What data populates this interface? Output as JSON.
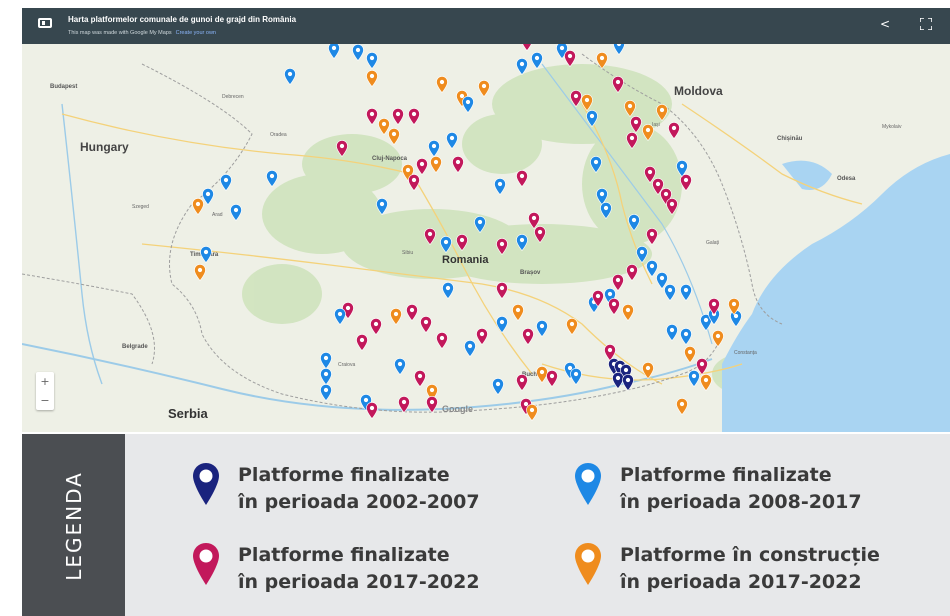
{
  "header": {
    "title": "Harta platformelor comunale de gunoi de grajd din România",
    "subtitle": "This map was made with Google My Maps",
    "subtitle_link": "Create your own",
    "menu_icon": "map-layers-icon",
    "share_icon": "share-icon",
    "fullscreen_icon": "fullscreen-icon"
  },
  "map": {
    "labels": {
      "hungary": "Hungary",
      "moldova": "Moldova",
      "romania": "Romania",
      "serbia": "Serbia",
      "budapest": "Budapest",
      "cluj": "Cluj-Napoca",
      "timisoara": "Timișoara",
      "bucharest": "Bucharest",
      "brasov": "Brașov",
      "chisinau": "Chișinău",
      "odesa": "Odesa",
      "belgrade": "Belgrade",
      "debrecen": "Debrecen",
      "oradea": "Oradea",
      "arad": "Arad",
      "szeged": "Szeged",
      "iasi": "Iași",
      "sibiu": "Sibiu",
      "craiova": "Craiova",
      "constanta": "Constanța",
      "galati": "Galați",
      "mykolaiv": "Mykolaiv"
    },
    "zoom_in": "+",
    "zoom_out": "−",
    "watermark": "Google"
  },
  "legend": {
    "title": "LEGENDA",
    "items": [
      {
        "line1": "Platforme finalizate",
        "line2": "în perioada 2002-2007",
        "color": "#1a237e"
      },
      {
        "line1": "Platforme finalizate",
        "line2": "în perioada 2008-2017",
        "color": "#1e88e5"
      },
      {
        "line1": "Platforme finalizate",
        "line2": "în perioada 2017-2022",
        "color": "#c2185b"
      },
      {
        "line1": "Platforme în construcție",
        "line2": "în perioada 2017-2022",
        "color": "#ef8c1e"
      }
    ]
  },
  "colors": {
    "header_bg": "#37474f",
    "legend_side": "#4b4e52",
    "legend_bg": "#e7e8ea",
    "sea": "#a9d4f2",
    "land": "#eef0e6"
  }
}
